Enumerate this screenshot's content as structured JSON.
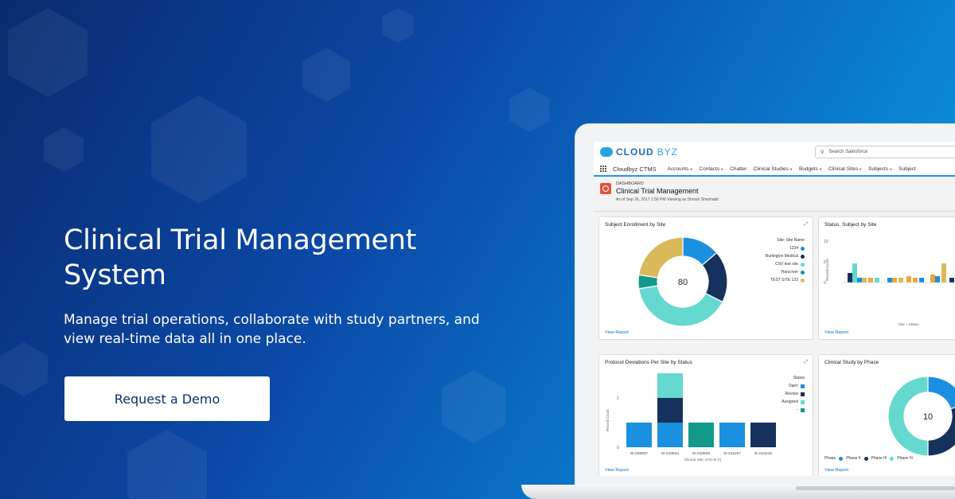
{
  "hero": {
    "title": "Clinical Trial Management System",
    "subtitle": "Manage trial operations, collaborate with study partners, and view real-time data all in one place.",
    "cta_label": "Request a Demo"
  },
  "app": {
    "logo_text_a": "CLOUD",
    "logo_text_b": "BYZ",
    "search_placeholder": "Search Salesforce",
    "app_name": "Cloudbyz CTMS",
    "nav": [
      "Accounts",
      "Contacts",
      "Chatter",
      "Clinical Studies",
      "Budgets",
      "Clinical Sites",
      "Subjects",
      "Subject"
    ],
    "dashboard_eyebrow": "DASHBOARD",
    "dashboard_title": "Clinical Trial Management",
    "dashboard_sub": "As of Sep 26, 2017 1:56 PM·Viewing as Dinesh Sheshadri",
    "view_report": "View Report"
  },
  "cards": {
    "enrollment": {
      "title": "Subject Enrollment by Site",
      "center_value": "80",
      "legend_title": "Site: Site Name",
      "legend": [
        {
          "label": "1234",
          "color": "#1b8fe0"
        },
        {
          "label": "Burlington Medical",
          "color": "#16325c"
        },
        {
          "label": "CSV test site",
          "color": "#65d8d0"
        },
        {
          "label": "Hancover",
          "color": "#12998a"
        },
        {
          "label": "TEST SITE 123",
          "color": "#d9b95a"
        }
      ]
    },
    "status_site": {
      "title": "Status, Subject by Site",
      "y_label": "Record Count",
      "x_label": "Site > Status",
      "ticks": [
        "10",
        "5",
        "0"
      ]
    },
    "deviations": {
      "title": "Protocol Deviations Per Site by Status",
      "y_label": "Record Count",
      "x_label": "Clinical Site: SYS-SI (I)",
      "y_ticks": [
        "2",
        "0"
      ],
      "legend_title": "Status",
      "legend": [
        {
          "label": "Open",
          "color": "#1b8fe0"
        },
        {
          "label": "Review",
          "color": "#16325c"
        },
        {
          "label": "Assigned",
          "color": "#65d8d0"
        },
        {
          "label": "-",
          "color": "#12998a"
        }
      ]
    },
    "phase": {
      "title": "Clinical Study by Phase",
      "center_value": "10",
      "legend_title": "Phase",
      "legend": [
        {
          "label": "Phase II",
          "color": "#1b8fe0"
        },
        {
          "label": "Phase III",
          "color": "#16325c"
        },
        {
          "label": "Phase IV",
          "color": "#65d8d0"
        }
      ]
    }
  },
  "chart_data": [
    {
      "type": "pie",
      "title": "Subject Enrollment by Site",
      "categories": [
        "1234",
        "Burlington Medical",
        "CSV test site",
        "Hancover",
        "TEST SITE 123"
      ],
      "values": [
        11,
        15,
        32,
        4,
        18
      ],
      "colors": [
        "#1b8fe0",
        "#16325c",
        "#65d8d0",
        "#12998a",
        "#d9b95a"
      ]
    },
    {
      "type": "bar",
      "title": "Protocol Deviations Per Site by Status",
      "categories": [
        "SI-009807",
        "SI-010844",
        "SI-010846",
        "SI-011257",
        "SI-014216"
      ],
      "series": [
        {
          "name": "Open",
          "values": [
            1,
            1,
            0,
            1,
            0
          ]
        },
        {
          "name": "Review",
          "values": [
            0,
            1,
            0,
            0,
            1
          ]
        },
        {
          "name": "Assigned",
          "values": [
            0,
            1,
            0,
            0,
            0
          ]
        },
        {
          "name": "-",
          "values": [
            0,
            0,
            1,
            0,
            0
          ]
        }
      ],
      "colors": [
        "#1b8fe0",
        "#16325c",
        "#65d8d0",
        "#12998a"
      ],
      "ylabel": "Record Count",
      "xlabel": "Clinical Site: SYS-SI (I)"
    },
    {
      "type": "pie",
      "title": "Clinical Study by Phase",
      "categories": [
        "Phase II",
        "Phase III",
        "Phase IV"
      ],
      "values": [
        2,
        3,
        5
      ],
      "colors": [
        "#1b8fe0",
        "#16325c",
        "#65d8d0"
      ]
    }
  ]
}
